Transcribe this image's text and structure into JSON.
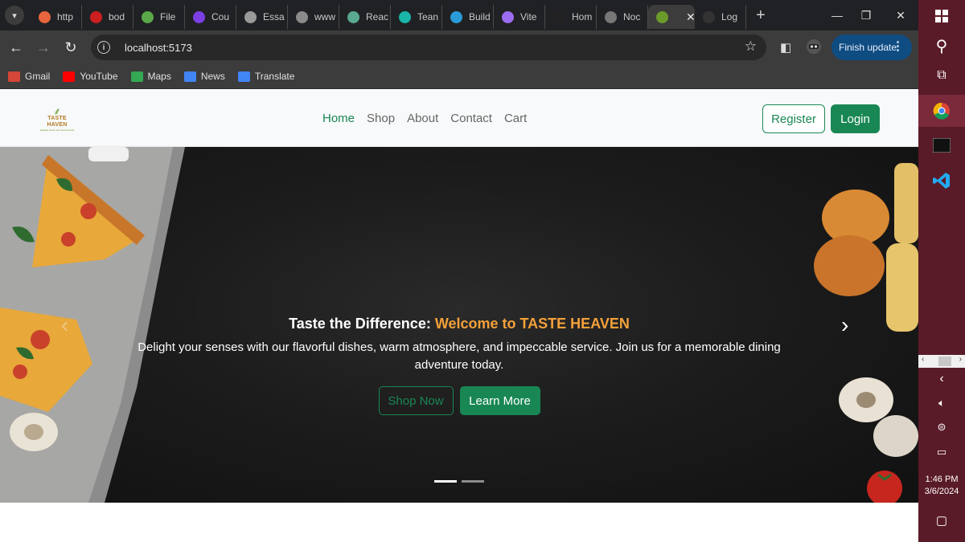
{
  "tabs": [
    {
      "label": "http",
      "icon": "orange-swirl-icon",
      "color": "#e8643c"
    },
    {
      "label": "bod",
      "icon": "n-logo-icon",
      "color": "#cc1f1f"
    },
    {
      "label": "File",
      "icon": "hexagon-icon",
      "color": "#5aa84a"
    },
    {
      "label": "Cou",
      "icon": "u-logo-icon",
      "color": "#7b3fe4"
    },
    {
      "label": "Essa",
      "icon": "gear-swirl-icon",
      "color": "#9a9a9a"
    },
    {
      "label": "www",
      "icon": "u-circle-icon",
      "color": "#8a8a8a"
    },
    {
      "label": "Reac",
      "icon": "openai-icon",
      "color": "#5aa890"
    },
    {
      "label": "Tean",
      "icon": "diamond-icon",
      "color": "#19b5a6"
    },
    {
      "label": "Build",
      "icon": "dotted-cross-icon",
      "color": "#2b9bd8"
    },
    {
      "label": "Vite",
      "icon": "vite-icon",
      "color": "#9b6cf0"
    },
    {
      "label": "Hom",
      "icon": "x-logo-icon",
      "color": "#222222"
    },
    {
      "label": "Noc",
      "icon": "circle-outline-icon",
      "color": "#777777"
    },
    {
      "label": "",
      "icon": "taste-haven-favicon",
      "color": "#6a9a2a",
      "active": true
    },
    {
      "label": "Log",
      "icon": "github-icon",
      "color": "#333333"
    }
  ],
  "toolbar": {
    "url": "localhost:5173",
    "finish_update": "Finish update"
  },
  "bookmarks": [
    {
      "label": "Gmail",
      "icon": "gmail-icon",
      "color": "#d44638"
    },
    {
      "label": "YouTube",
      "icon": "youtube-icon",
      "color": "#ff0000"
    },
    {
      "label": "Maps",
      "icon": "maps-pin-icon",
      "color": "#34a853"
    },
    {
      "label": "News",
      "icon": "news-icon",
      "color": "#4285f4"
    },
    {
      "label": "Translate",
      "icon": "translate-icon",
      "color": "#4285f4"
    }
  ],
  "site": {
    "logo_title": "TASTE HAVEN",
    "logo_subtitle": "Healthy, Fresh and Good Foods",
    "nav": [
      "Home",
      "Shop",
      "About",
      "Contact",
      "Cart"
    ],
    "register": "Register",
    "login": "Login",
    "accent_color": "#198754"
  },
  "hero": {
    "title_prefix": "Taste the Difference: ",
    "title_accent": "Welcome to TASTE HEAVEN",
    "description": "Delight your senses with our flavorful dishes, warm atmosphere, and impeccable service. Join us for a memorable dining adventure today.",
    "shop_now": "Shop Now",
    "learn_more": "Learn More",
    "slides": 2,
    "active_slide": 1
  },
  "taskbar": {
    "time": "1:46 PM",
    "date": "3/6/2024"
  }
}
